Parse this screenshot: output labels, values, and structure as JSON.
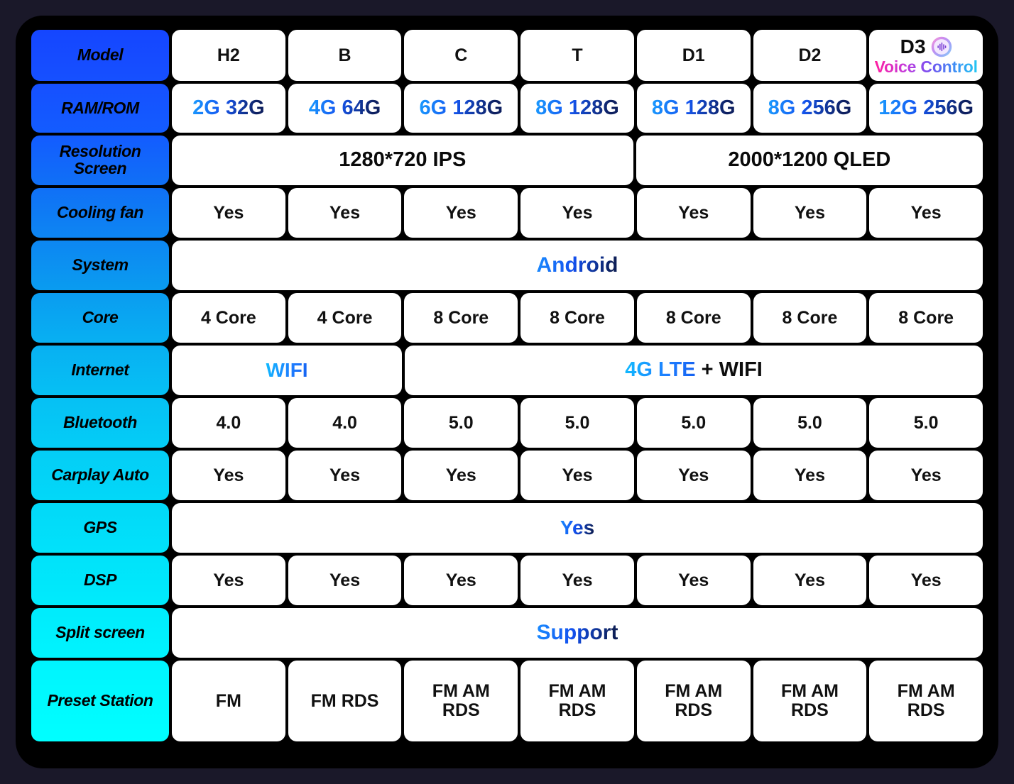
{
  "theme": {
    "page_background": "#1a1829",
    "board_background": "#000000",
    "cell_background": "#ffffff",
    "label_gradient_start": "#1546ff",
    "label_gradient_end": "#00ffff",
    "accent_blue": "#1556f0",
    "accent_cyan": "#11bcff",
    "voice_gradient_start": "#ff1fa0",
    "voice_gradient_end": "#22c9f2"
  },
  "table": {
    "columns": 7,
    "rows": [
      {
        "label": "Model",
        "cells": [
          {
            "text": "H2",
            "span": 1,
            "style": "plain"
          },
          {
            "text": "B",
            "span": 1,
            "style": "plain"
          },
          {
            "text": "C",
            "span": 1,
            "style": "plain"
          },
          {
            "text": "T",
            "span": 1,
            "style": "plain"
          },
          {
            "text": "D1",
            "span": 1,
            "style": "plain"
          },
          {
            "text": "D2",
            "span": 1,
            "style": "plain"
          },
          {
            "text": "D3",
            "span": 1,
            "style": "voice",
            "sub": "Voice Control",
            "icon": "voice-waveform-icon"
          }
        ]
      },
      {
        "label": "RAM/ROM",
        "cells": [
          {
            "text": "2G 32G",
            "span": 1,
            "style": "grad-blue"
          },
          {
            "text": "4G 64G",
            "span": 1,
            "style": "grad-blue"
          },
          {
            "text": "6G 128G",
            "span": 1,
            "style": "grad-blue"
          },
          {
            "text": "8G 128G",
            "span": 1,
            "style": "grad-blue"
          },
          {
            "text": "8G 128G",
            "span": 1,
            "style": "grad-blue"
          },
          {
            "text": "8G 256G",
            "span": 1,
            "style": "grad-blue"
          },
          {
            "text": "12G 256G",
            "span": 1,
            "style": "grad-blue"
          }
        ]
      },
      {
        "label": "Resolution Screen",
        "label_line1": "Resolution",
        "label_line2": "Screen",
        "cells": [
          {
            "text": "1280*720 IPS",
            "span": 4,
            "style": "res"
          },
          {
            "text": "2000*1200 QLED",
            "span": 3,
            "style": "res"
          }
        ]
      },
      {
        "label": "Cooling fan",
        "cells": [
          {
            "text": "Yes",
            "span": 1,
            "style": "plain"
          },
          {
            "text": "Yes",
            "span": 1,
            "style": "plain"
          },
          {
            "text": "Yes",
            "span": 1,
            "style": "plain"
          },
          {
            "text": "Yes",
            "span": 1,
            "style": "plain"
          },
          {
            "text": "Yes",
            "span": 1,
            "style": "plain"
          },
          {
            "text": "Yes",
            "span": 1,
            "style": "plain"
          },
          {
            "text": "Yes",
            "span": 1,
            "style": "plain"
          }
        ]
      },
      {
        "label": "System",
        "cells": [
          {
            "text": "Android",
            "span": 7,
            "style": "grad-blue-wide"
          }
        ]
      },
      {
        "label": "Core",
        "cells": [
          {
            "text": "4 Core",
            "span": 1,
            "style": "plain"
          },
          {
            "text": "4 Core",
            "span": 1,
            "style": "plain"
          },
          {
            "text": "8 Core",
            "span": 1,
            "style": "plain"
          },
          {
            "text": "8 Core",
            "span": 1,
            "style": "plain"
          },
          {
            "text": "8 Core",
            "span": 1,
            "style": "plain"
          },
          {
            "text": "8 Core",
            "span": 1,
            "style": "plain"
          },
          {
            "text": "8 Core",
            "span": 1,
            "style": "plain"
          }
        ]
      },
      {
        "label": "Internet",
        "cells": [
          {
            "text": "WIFI",
            "span": 2,
            "style": "grad-cyan"
          },
          {
            "text": "4G LTE + WIFI",
            "span": 5,
            "style": "mixed",
            "colored_part": "4G LTE",
            "plain_part": " + WIFI"
          }
        ]
      },
      {
        "label": "Bluetooth",
        "cells": [
          {
            "text": "4.0",
            "span": 1,
            "style": "plain"
          },
          {
            "text": "4.0",
            "span": 1,
            "style": "plain"
          },
          {
            "text": "5.0",
            "span": 1,
            "style": "plain"
          },
          {
            "text": "5.0",
            "span": 1,
            "style": "plain"
          },
          {
            "text": "5.0",
            "span": 1,
            "style": "plain"
          },
          {
            "text": "5.0",
            "span": 1,
            "style": "plain"
          },
          {
            "text": "5.0",
            "span": 1,
            "style": "plain"
          }
        ]
      },
      {
        "label": "Carplay Auto",
        "cells": [
          {
            "text": "Yes",
            "span": 1,
            "style": "plain"
          },
          {
            "text": "Yes",
            "span": 1,
            "style": "plain"
          },
          {
            "text": "Yes",
            "span": 1,
            "style": "plain"
          },
          {
            "text": "Yes",
            "span": 1,
            "style": "plain"
          },
          {
            "text": "Yes",
            "span": 1,
            "style": "plain"
          },
          {
            "text": "Yes",
            "span": 1,
            "style": "plain"
          },
          {
            "text": "Yes",
            "span": 1,
            "style": "plain"
          }
        ]
      },
      {
        "label": "GPS",
        "cells": [
          {
            "text": "Yes",
            "span": 7,
            "style": "grad-blue-wide"
          }
        ]
      },
      {
        "label": "DSP",
        "cells": [
          {
            "text": "Yes",
            "span": 1,
            "style": "plain"
          },
          {
            "text": "Yes",
            "span": 1,
            "style": "plain"
          },
          {
            "text": "Yes",
            "span": 1,
            "style": "plain"
          },
          {
            "text": "Yes",
            "span": 1,
            "style": "plain"
          },
          {
            "text": "Yes",
            "span": 1,
            "style": "plain"
          },
          {
            "text": "Yes",
            "span": 1,
            "style": "plain"
          },
          {
            "text": "Yes",
            "span": 1,
            "style": "plain"
          }
        ]
      },
      {
        "label": "Split screen",
        "cells": [
          {
            "text": "Support",
            "span": 7,
            "style": "grad-blue-wide"
          }
        ]
      },
      {
        "label": "Preset Station",
        "cells": [
          {
            "text": "FM",
            "span": 1,
            "style": "plain"
          },
          {
            "text": "FM RDS",
            "span": 1,
            "style": "plain"
          },
          {
            "text": "FM AM RDS",
            "span": 1,
            "style": "plain",
            "line1": "FM AM",
            "line2": "RDS"
          },
          {
            "text": "FM AM RDS",
            "span": 1,
            "style": "plain",
            "line1": "FM AM",
            "line2": "RDS"
          },
          {
            "text": "FM AM RDS",
            "span": 1,
            "style": "plain",
            "line1": "FM AM",
            "line2": "RDS"
          },
          {
            "text": "FM AM RDS",
            "span": 1,
            "style": "plain",
            "line1": "FM AM",
            "line2": "RDS"
          },
          {
            "text": "FM AM RDS",
            "span": 1,
            "style": "plain",
            "line1": "FM AM",
            "line2": "RDS"
          }
        ]
      }
    ]
  }
}
